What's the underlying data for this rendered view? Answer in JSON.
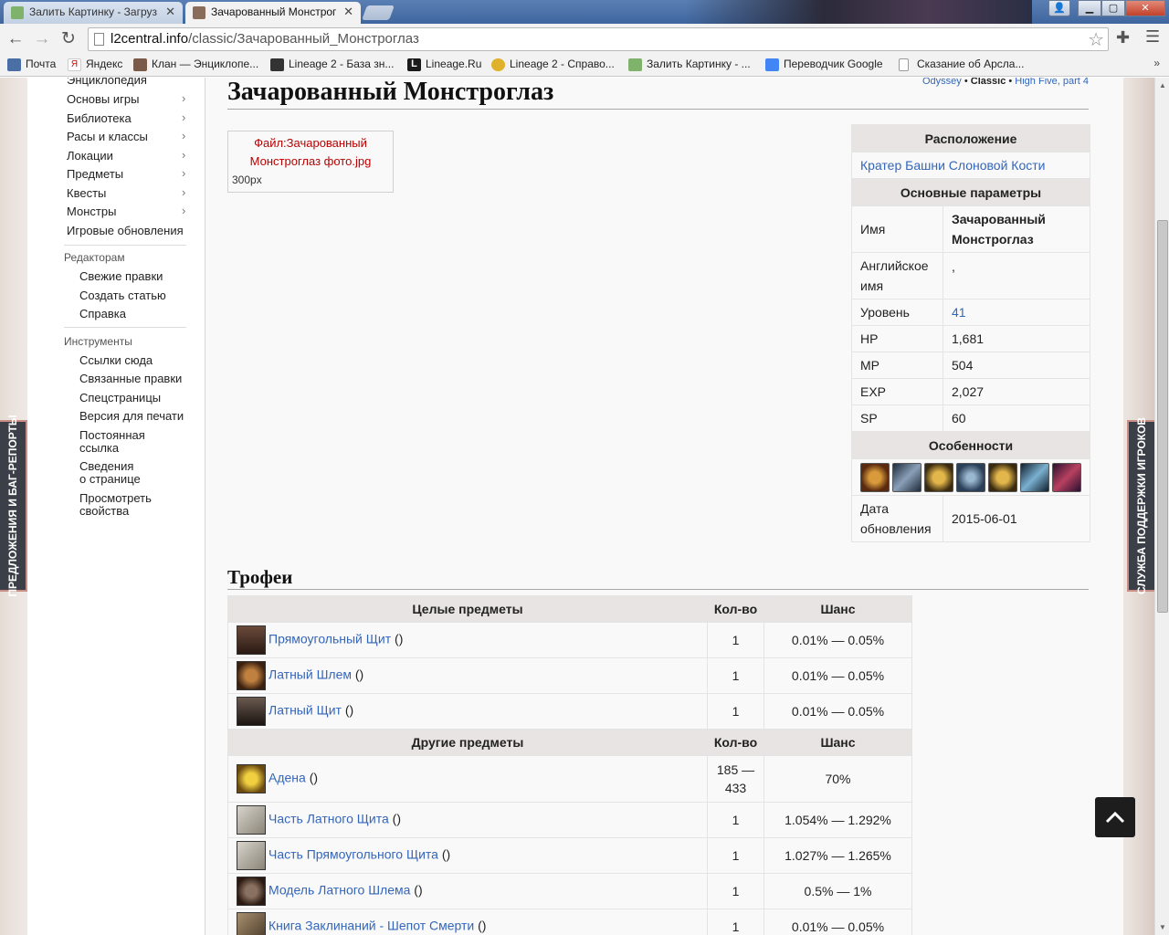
{
  "browser": {
    "tabs": [
      {
        "title": "Залить Картинку - Загруз",
        "active": false
      },
      {
        "title": "Зачарованный Монстрог",
        "active": true
      }
    ],
    "url_host": "l2central.info",
    "url_path": "/classic/Зачарованный_Монстроглаз",
    "bookmarks": [
      "Почта",
      "Яндекс",
      "Клан — Энциклопе...",
      "Lineage 2 - База зн...",
      "Lineage.Ru",
      "Lineage 2 - Справо...",
      "Залить Картинку - ...",
      "Переводчик Google",
      "Сказание об Арсла..."
    ],
    "bookmarks_more": "»"
  },
  "sidebar": {
    "nav": [
      {
        "label": "Энциклопедия",
        "arrow": false
      },
      {
        "label": "Основы игры",
        "arrow": true
      },
      {
        "label": "Библиотека",
        "arrow": true
      },
      {
        "label": "Расы и классы",
        "arrow": true
      },
      {
        "label": "Локации",
        "arrow": true
      },
      {
        "label": "Предметы",
        "arrow": true
      },
      {
        "label": "Квесты",
        "arrow": true
      },
      {
        "label": "Монстры",
        "arrow": true
      },
      {
        "label": "Игровые обновления",
        "arrow": false
      }
    ],
    "editors_heading": "Редакторам",
    "editors": [
      "Свежие правки",
      "Создать статью",
      "Справка"
    ],
    "tools_heading": "Инструменты",
    "tools": [
      "Ссылки сюда",
      "Связанные правки",
      "Спецстраницы",
      "Версия для печати",
      "Постоянная\nссылка",
      "Сведения\nо странице",
      "Просмотреть\nсвойства"
    ]
  },
  "side_tabs": {
    "left": "ПРЕДЛОЖЕНИЯ И БАГ-РЕПОРТЫ",
    "right": "СЛУЖБА ПОДДЕРЖКИ ИГРОКОВ"
  },
  "versions": {
    "odyssey": "Odyssey",
    "classic": "Classic",
    "highfive": "High Five, part 4"
  },
  "page_title": "Зачарованный Монстроглаз",
  "image_thumb": {
    "file_link": "Файл:Зачарованный Монстроглаз фото.jpg",
    "caption": "300px"
  },
  "infobox": {
    "location_header": "Расположение",
    "location": "Кратер Башни Слоновой Кости",
    "params_header": "Основные параметры",
    "name_label": "Имя",
    "name_value": "Зачарованный Монстроглаз",
    "english_label": "Английское имя",
    "english_value": ",",
    "level_label": "Уровень",
    "level_value": "41",
    "hp_label": "HP",
    "hp_value": "1,681",
    "mp_label": "MP",
    "mp_value": "504",
    "exp_label": "EXP",
    "exp_value": "2,027",
    "sp_label": "SP",
    "sp_value": "60",
    "features_header": "Особенности",
    "skill_icons": [
      "face-icon",
      "sword-icon",
      "lion-10-icon",
      "swirl-icon",
      "lion-10-icon",
      "wave-icon",
      "spear-icon"
    ],
    "updated_label": "Дата обновления",
    "updated_value": "2015-06-01"
  },
  "trophies": {
    "title": "Трофеи",
    "whole_header": "Целые предметы",
    "other_header": "Другие предметы",
    "count_header": "Кол-во",
    "chance_header": "Шанс",
    "whole_items": [
      {
        "name": "Прямоугольный Щит",
        "suffix": " ()",
        "count": "1",
        "chance": "0.01% — 0.05%",
        "icon": "shield-icon"
      },
      {
        "name": "Латный Шлем",
        "suffix": " ()",
        "count": "1",
        "chance": "0.01% — 0.05%",
        "icon": "helmet-icon"
      },
      {
        "name": "Латный Щит",
        "suffix": " ()",
        "count": "1",
        "chance": "0.01% — 0.05%",
        "icon": "plate-shield-icon"
      }
    ],
    "other_items": [
      {
        "name": "Адена",
        "suffix": " ()",
        "count": "185 —\n433",
        "chance": "70%",
        "icon": "adena-icon"
      },
      {
        "name": "Часть Латного Щита",
        "suffix": " ()",
        "count": "1",
        "chance": "1.054% — 1.292%",
        "icon": "scroll-icon"
      },
      {
        "name": "Часть Прямоугольного Щита",
        "suffix": " ()",
        "count": "1",
        "chance": "1.027% — 1.265%",
        "icon": "scroll-icon"
      },
      {
        "name": "Модель Латного Шлема",
        "suffix": " ()",
        "count": "1",
        "chance": "0.5% — 1%",
        "icon": "pouch-icon"
      },
      {
        "name": "Книга Заклинаний - Шепот Смерти",
        "suffix": " ()",
        "count": "1",
        "chance": "0.01% — 0.05%",
        "icon": "book-icon"
      }
    ]
  }
}
